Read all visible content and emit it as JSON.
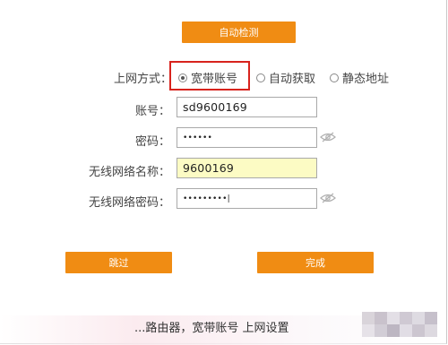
{
  "buttons": {
    "auto_detect": "自动检测",
    "skip": "跳过",
    "done": "完成"
  },
  "connection": {
    "label": "上网方式：",
    "options": [
      {
        "label": "宽带账号",
        "selected": true
      },
      {
        "label": "自动获取",
        "selected": false
      },
      {
        "label": "静态地址",
        "selected": false
      }
    ]
  },
  "form": {
    "account_label": "账号：",
    "account_value": "sd9600169",
    "password_label": "密码：",
    "password_value": "••••••",
    "ssid_label": "无线网络名称：",
    "ssid_value": "9600169",
    "wifi_password_label": "无线网络密码：",
    "wifi_password_value": "•••••••••|"
  },
  "caption": {
    "text": "     ...路由器，宽带账号 上网设置"
  },
  "colors": {
    "accent": "#f08c13",
    "highlight": "#d8231d",
    "autofill": "#fcfbc4"
  }
}
